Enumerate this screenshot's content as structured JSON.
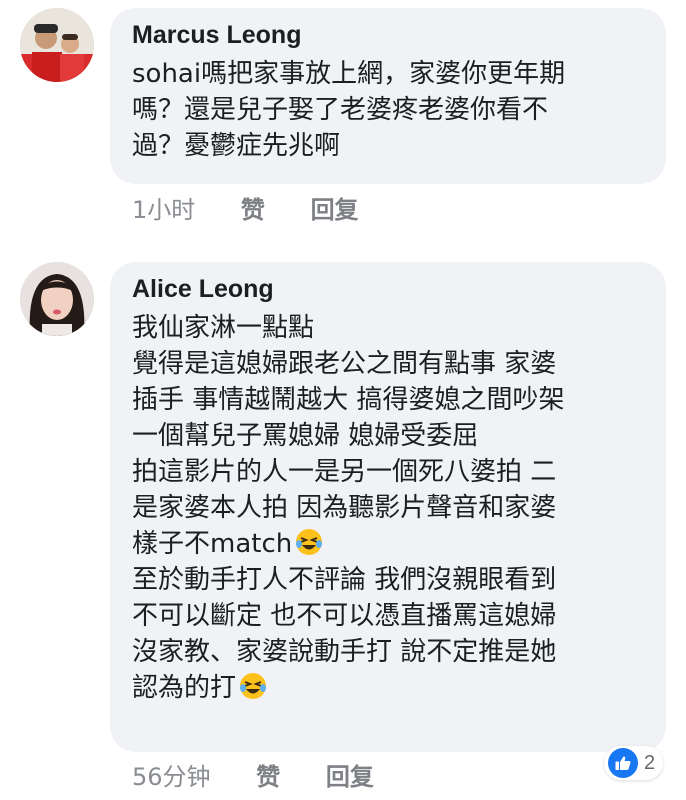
{
  "comments": [
    {
      "author": "Marcus Leong",
      "lines": [
        "sohai嗎把家事放上網，家婆你更年期",
        "嗎？還是兒子娶了老婆疼老婆你看不",
        "過？憂鬱症先兆啊"
      ],
      "time": "1小时",
      "like_label": "赞",
      "reply_label": "回复"
    },
    {
      "author": "Alice Leong",
      "lines": [
        "我仙家淋一點點",
        "覺得是這媳婦跟老公之間有點事 家婆",
        "插手 事情越鬧越大 搞得婆媳之間吵架",
        "一個幫兒子罵媳婦 媳婦受委屈",
        "拍這影片的人一是另一個死八婆拍 二",
        "是家婆本人拍 因為聽影片聲音和家婆",
        "樣子不match",
        "至於動手打人不評論 我們沒親眼看到",
        "不可以斷定 也不可以憑直播罵這媳婦",
        "沒家教、家婆說動手打 說不定推是她",
        "認為的打"
      ],
      "time": "56分钟",
      "like_label": "赞",
      "reply_label": "回复",
      "reaction_count": "2",
      "reaction_icon": "like-icon"
    }
  ],
  "colors": {
    "bubble": "#f0f2f5",
    "like_blue": "#1877f2",
    "meta_gray": "#8a8d91"
  }
}
